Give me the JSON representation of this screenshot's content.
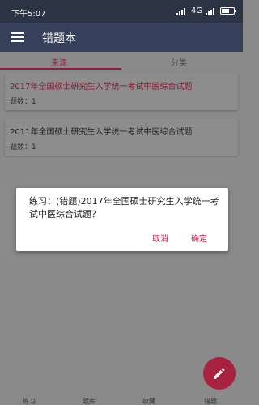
{
  "status": {
    "time": "下午5:07",
    "network": "4G"
  },
  "appbar": {
    "title": "错题本"
  },
  "tabs": [
    {
      "label": "来源"
    },
    {
      "label": "分类"
    }
  ],
  "cards": [
    {
      "title": "2017年全国硕士研究生入学统一考试中医综合试题",
      "count": "题数：1"
    },
    {
      "title": "2011年全国硕士研究生入学统一考试中医综合试题",
      "count": "题数：1"
    }
  ],
  "dialog": {
    "message": "练习：(错题)2017年全国硕士研究生入学统一考试中医综合试题？",
    "cancel": "取消",
    "ok": "确定"
  },
  "bottom_nav": [
    {
      "label": "练习"
    },
    {
      "label": "题库"
    },
    {
      "label": "收藏"
    },
    {
      "label": "错题"
    }
  ],
  "colors": {
    "accent": "#c42856",
    "appbar": "#37405a"
  }
}
